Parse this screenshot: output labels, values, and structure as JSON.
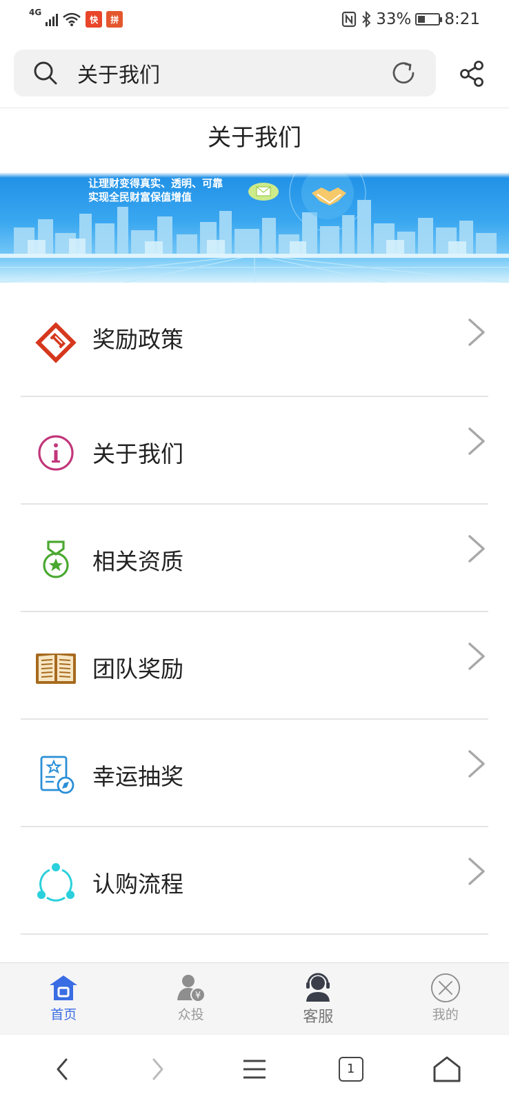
{
  "status_bar": {
    "network_label": "4G",
    "app_badge_1": "快",
    "app_badge_2": "拼",
    "battery_percent": "33%",
    "battery_level": 0.33,
    "time": "8:21"
  },
  "search": {
    "value": "关于我们"
  },
  "page": {
    "title": "关于我们"
  },
  "banner": {
    "slogan_line1": "让理财变得真实、透明、可靠",
    "slogan_line2": "实现全民财富保值增值"
  },
  "menu": {
    "items": [
      {
        "label": "奖励政策",
        "icon": "gift-ticket-icon",
        "color": "#d6381e"
      },
      {
        "label": "关于我们",
        "icon": "info-circle-icon",
        "color": "#c2367a"
      },
      {
        "label": "相关资质",
        "icon": "medal-icon",
        "color": "#4aa830"
      },
      {
        "label": "团队奖励",
        "icon": "book-icon",
        "color": "#a66a1e"
      },
      {
        "label": "幸运抽奖",
        "icon": "certificate-icon",
        "color": "#2a8fd6"
      },
      {
        "label": "认购流程",
        "icon": "cycle-dots-icon",
        "color": "#2ad0dc"
      }
    ]
  },
  "tab_bar": {
    "items": [
      {
        "label": "首页",
        "icon": "home-icon",
        "active": true
      },
      {
        "label": "众投",
        "icon": "user-yen-icon",
        "active": false
      },
      {
        "label": "客服",
        "icon": "customer-service-icon",
        "active": false
      },
      {
        "label": "我的",
        "icon": "close-circle-icon",
        "active": false
      }
    ],
    "active_color": "#3a6de3"
  },
  "nav_bar": {
    "tab_count": "1"
  }
}
